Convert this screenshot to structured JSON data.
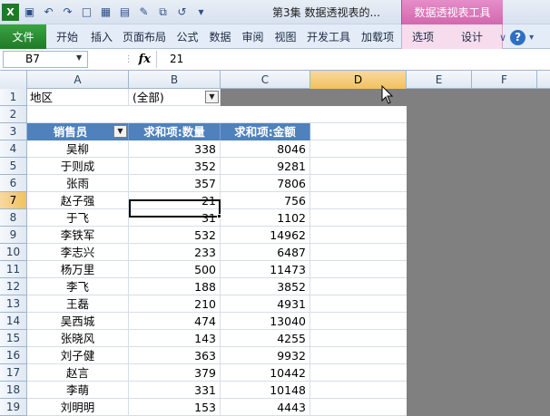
{
  "titlebar": {
    "doc_title": "第3集 数据透视表的...",
    "context_title": "数据透视表工具",
    "qat_icons": [
      "excel-icon",
      "save-icon",
      "undo-icon",
      "redo-icon",
      "new-doc-icon",
      "table-icon",
      "form-icon",
      "brush-icon",
      "print-preview-icon",
      "undo-arrow-icon",
      "dropdown-icon"
    ]
  },
  "ribbon": {
    "file_tab": "文件",
    "tabs": [
      "开始",
      "插入",
      "页面布局",
      "公式",
      "数据",
      "审阅",
      "视图",
      "开发工具",
      "加载项"
    ],
    "context_tabs": [
      "选项",
      "设计"
    ]
  },
  "formula_bar": {
    "name_box": "B7",
    "fx_label": "fx",
    "value": "21"
  },
  "columns": [
    "A",
    "B",
    "C",
    "D",
    "E",
    "F"
  ],
  "rows": [
    "1",
    "2",
    "3",
    "4",
    "5",
    "6",
    "7",
    "8",
    "9",
    "10",
    "11",
    "12",
    "13",
    "14",
    "15",
    "16",
    "17",
    "18",
    "19"
  ],
  "pivot": {
    "filter_label": "地区",
    "filter_value": "(全部)",
    "headers": [
      "销售员",
      "求和项:数量",
      "求和项:金额"
    ],
    "records": [
      {
        "name": "吴柳",
        "qty": "338",
        "amount": "8046"
      },
      {
        "name": "于则成",
        "qty": "352",
        "amount": "9281"
      },
      {
        "name": "张雨",
        "qty": "357",
        "amount": "7806"
      },
      {
        "name": "赵子强",
        "qty": "21",
        "amount": "756"
      },
      {
        "name": "于飞",
        "qty": "31",
        "amount": "1102"
      },
      {
        "name": "李铁军",
        "qty": "532",
        "amount": "14962"
      },
      {
        "name": "李志兴",
        "qty": "233",
        "amount": "6487"
      },
      {
        "name": "杨万里",
        "qty": "500",
        "amount": "11473"
      },
      {
        "name": "李飞",
        "qty": "188",
        "amount": "3852"
      },
      {
        "name": "王磊",
        "qty": "210",
        "amount": "4931"
      },
      {
        "name": "吴西城",
        "qty": "474",
        "amount": "13040"
      },
      {
        "name": "张晓风",
        "qty": "143",
        "amount": "4255"
      },
      {
        "name": "刘子健",
        "qty": "363",
        "amount": "9932"
      },
      {
        "name": "赵言",
        "qty": "379",
        "amount": "10442"
      },
      {
        "name": "李萌",
        "qty": "331",
        "amount": "10148"
      },
      {
        "name": "刘明明",
        "qty": "153",
        "amount": "4443"
      }
    ]
  },
  "colors": {
    "header_blue": "#4f81bd",
    "file_green": "#1f7a28",
    "context_pink": "#d367ae",
    "selection_orange": "#f1c15f"
  }
}
